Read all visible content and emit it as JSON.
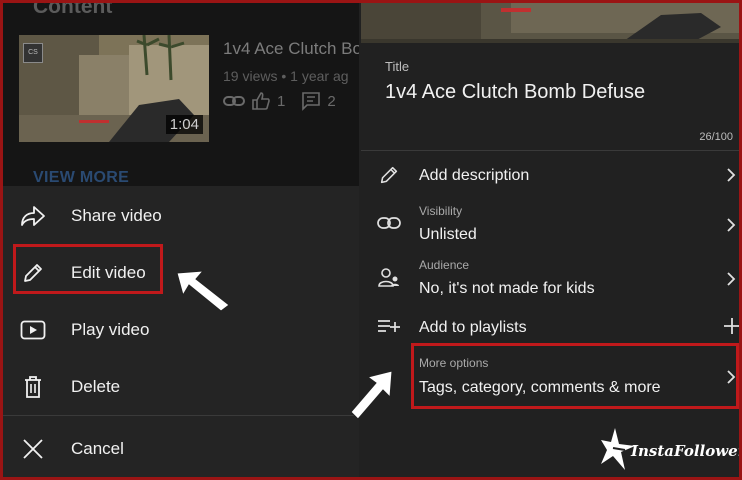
{
  "left_panel": {
    "section_heading": "Content",
    "video": {
      "title": "1v4 Ace Clutch Bo",
      "meta": "19 views • 1 year ag",
      "likes": "1",
      "comments": "2",
      "duration": "1:04"
    },
    "view_more": "VIEW MORE",
    "menu": [
      {
        "icon": "share-icon",
        "label": "Share video"
      },
      {
        "icon": "pencil-icon",
        "label": "Edit video"
      },
      {
        "icon": "play-icon",
        "label": "Play video"
      },
      {
        "icon": "trash-icon",
        "label": "Delete"
      }
    ],
    "cancel": {
      "icon": "close-icon",
      "label": "Cancel"
    }
  },
  "right_panel": {
    "title_label": "Title",
    "title_value": "1v4 Ace Clutch Bomb Defuse",
    "char_count": "26/100",
    "rows": {
      "description": {
        "label": "Add description"
      },
      "visibility": {
        "sub": "Visibility",
        "value": "Unlisted"
      },
      "audience": {
        "sub": "Audience",
        "value": "No, it's not made for kids"
      },
      "playlists": {
        "label": "Add to playlists"
      },
      "more_options": {
        "sub": "More options",
        "value": "Tags, category, comments & more"
      }
    }
  },
  "watermark": {
    "text": "InstaFollowers"
  },
  "colors": {
    "highlight": "#c0191b",
    "background": "#212121",
    "link": "#2a4a72"
  }
}
